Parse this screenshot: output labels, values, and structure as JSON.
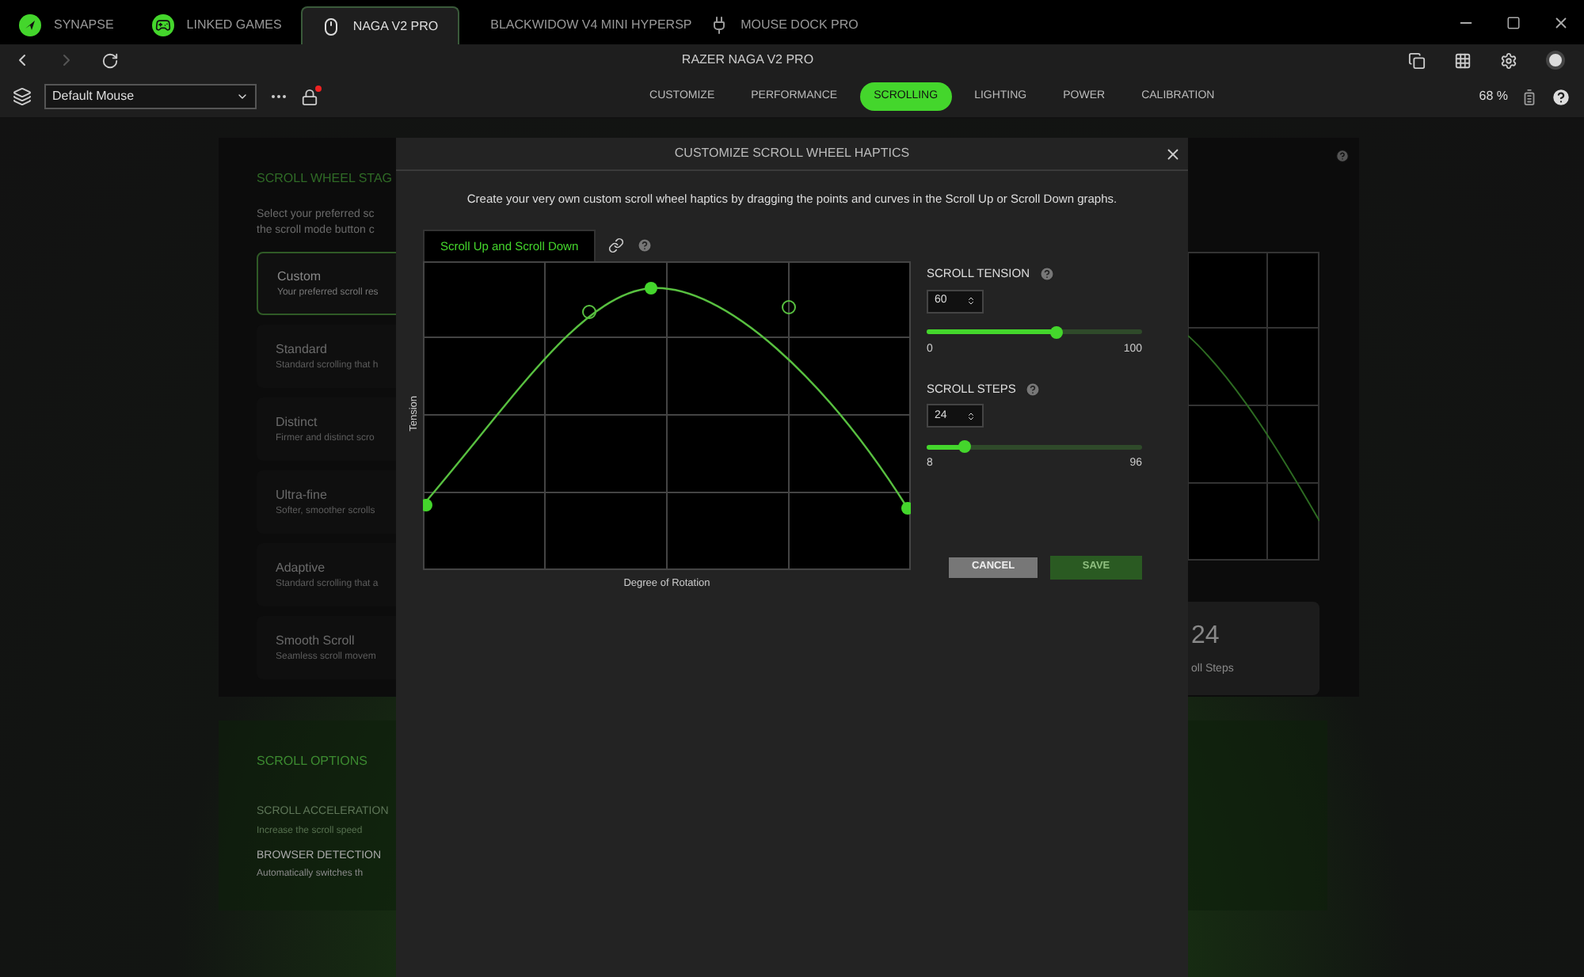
{
  "app_tabs": [
    {
      "label": "SYNAPSE",
      "kind": "logo",
      "selected": false
    },
    {
      "label": "LINKED GAMES",
      "kind": "games",
      "selected": false
    },
    {
      "label": "NAGA V2 PRO",
      "kind": "mouse",
      "selected": true
    },
    {
      "label": "BLACKWIDOW V4 MINI HYPERSP",
      "kind": "keyboard",
      "selected": false
    },
    {
      "label": "MOUSE DOCK PRO",
      "kind": "dock",
      "selected": false
    }
  ],
  "device_title": "RAZER NAGA V2 PRO",
  "profile": {
    "value": "Default Mouse"
  },
  "sections": [
    {
      "label": "CUSTOMIZE",
      "selected": false
    },
    {
      "label": "PERFORMANCE",
      "selected": false
    },
    {
      "label": "SCROLLING",
      "selected": true
    },
    {
      "label": "LIGHTING",
      "selected": false
    },
    {
      "label": "POWER",
      "selected": false
    },
    {
      "label": "CALIBRATION",
      "selected": false
    }
  ],
  "battery": "68 %",
  "background": {
    "stages_title": "SCROLL WHEEL STAG",
    "stages_desc": [
      "Select your preferred sc",
      "the scroll mode button c"
    ],
    "stages": [
      {
        "name": "Custom",
        "desc": "Your preferred scroll res",
        "selected": true
      },
      {
        "name": "Standard",
        "desc": "Standard scrolling that h",
        "selected": false
      },
      {
        "name": "Distinct",
        "desc": "Firmer and distinct scro",
        "selected": false
      },
      {
        "name": "Ultra-fine",
        "desc": "Softer, smoother scrolls",
        "selected": false
      },
      {
        "name": "Adaptive",
        "desc": "Standard scrolling that a",
        "selected": false
      },
      {
        "name": "Smooth Scroll",
        "desc": "Seamless scroll movem",
        "selected": false
      }
    ],
    "steps_value": "24",
    "steps_label": "oll Steps",
    "options_title": "SCROLL OPTIONS",
    "options": [
      {
        "name": "SCROLL ACCELERATION",
        "desc": "Increase the scroll speed",
        "disabled": true
      },
      {
        "name": "BROWSER DETECTION",
        "desc": "Automatically switches th",
        "disabled": false
      }
    ]
  },
  "modal": {
    "title": "CUSTOMIZE SCROLL WHEEL HAPTICS",
    "description": "Create your very own custom scroll wheel haptics by dragging the points and curves in the Scroll Up or Scroll Down graphs.",
    "graph_tabs": [
      {
        "label": "Scroll Up and Scroll Down",
        "selected": true
      }
    ],
    "y_axis_label": "Tension",
    "x_axis_label": "Degree of Rotation",
    "settings": [
      {
        "label": "SCROLL TENSION",
        "value": "60",
        "level": 0.6,
        "min": "0",
        "max": "100"
      },
      {
        "label": "SCROLL STEPS",
        "value": "24",
        "level": 0.18,
        "min": "8",
        "max": "96"
      }
    ],
    "buttons": [
      {
        "label": "CANCEL",
        "kind": "secondary",
        "disabled": false
      },
      {
        "label": "SAVE",
        "kind": "primary",
        "disabled": true
      }
    ]
  }
}
